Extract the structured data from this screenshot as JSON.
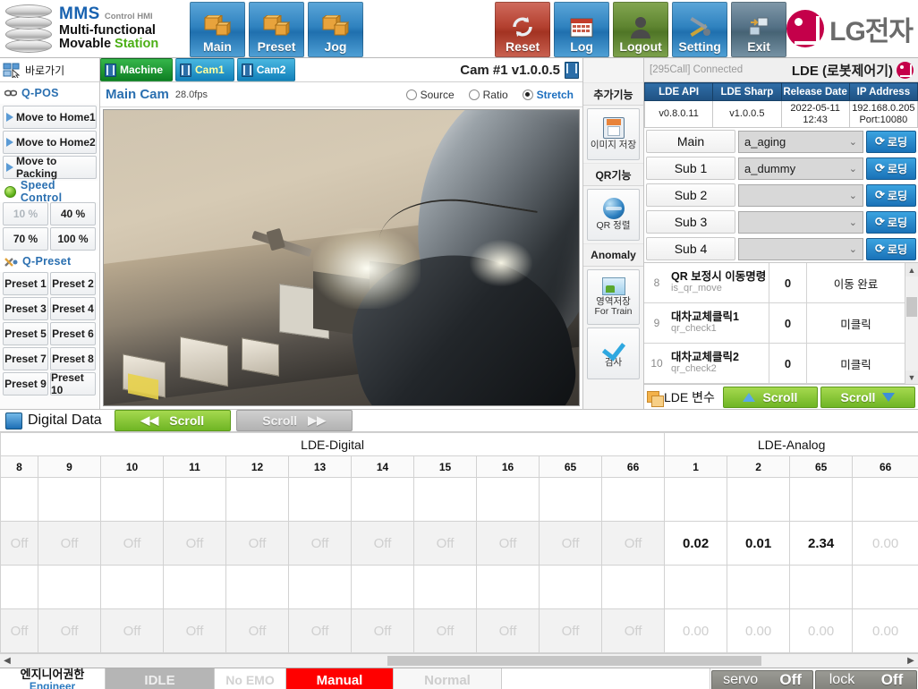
{
  "brand": {
    "mms": "MMS",
    "hmi_sub": "Control HMI",
    "line2": "Multi-functional",
    "line3a": "Movable ",
    "line3b": "Station",
    "lg_text": "LG전자"
  },
  "toolbar": {
    "buttons": [
      {
        "label": "Main",
        "icon": "boxes-icon",
        "color": "#2f82bf"
      },
      {
        "label": "Preset",
        "icon": "boxes-icon",
        "color": "#2f82bf"
      },
      {
        "label": "Jog",
        "icon": "boxes-icon",
        "color": "#2f82bf"
      },
      {
        "label": "Reset",
        "icon": "refresh-icon",
        "color": "#b3402f"
      },
      {
        "label": "Log",
        "icon": "calendar-icon",
        "color": "#2f82bf"
      },
      {
        "label": "Logout",
        "icon": "user-icon",
        "color": "#5e8430"
      },
      {
        "label": "Setting",
        "icon": "tools-icon",
        "color": "#2f82bf"
      },
      {
        "label": "Exit",
        "icon": "exit-icon",
        "color": "#547186"
      }
    ]
  },
  "sidebar": {
    "header": "바로가기",
    "qpos": {
      "title": "Q-POS",
      "items": [
        "Move to Home1",
        "Move to Home2",
        "Move to Packing"
      ]
    },
    "speed": {
      "title": "Speed Control",
      "options": [
        "10 %",
        "40 %",
        "70 %",
        "100 %"
      ],
      "dim_index": 0
    },
    "preset": {
      "title": "Q-Preset",
      "items": [
        "Preset 1",
        "Preset 2",
        "Preset 3",
        "Preset 4",
        "Preset 5",
        "Preset 6",
        "Preset 7",
        "Preset 8",
        "Preset 9",
        "Preset 10"
      ]
    }
  },
  "camera": {
    "tabs": [
      {
        "label": "Machine",
        "active": true
      },
      {
        "label": "Cam1",
        "active": false
      },
      {
        "label": "Cam2",
        "active": false
      }
    ],
    "title": "Cam #1 v1.0.0.5",
    "name": "Main Cam",
    "fps": "28.0fps",
    "modes": [
      {
        "label": "Source",
        "selected": false
      },
      {
        "label": "Ratio",
        "selected": false
      },
      {
        "label": "Stretch",
        "selected": true
      }
    ]
  },
  "functions": {
    "groups": [
      {
        "title": "추가기능",
        "buttons": [
          {
            "label": "이미지 저장",
            "icon": "floppy-icon"
          }
        ]
      },
      {
        "title": "QR기능",
        "buttons": [
          {
            "label": "QR 정렬",
            "icon": "globe-icon"
          }
        ]
      },
      {
        "title": "Anomaly",
        "buttons": [
          {
            "label": "영역저장\nFor Train",
            "icon": "image-icon"
          },
          {
            "label": "검사",
            "icon": "check-icon"
          }
        ]
      }
    ],
    "anomaly_btn1_line1": "영역저장",
    "anomaly_btn1_line2": "For Train",
    "anomaly_btn2": "검사"
  },
  "lde": {
    "connection": "[295Call] Connected",
    "title": "LDE (로봇제어기)",
    "info_headers": [
      "LDE API",
      "LDE Sharp",
      "Release Date",
      "IP Address"
    ],
    "info_values": [
      "v0.8.0.11",
      "v1.0.0.5",
      "2022-05-11\n12:43",
      "192.168.0.205\nPort:10080"
    ],
    "release_date_line1": "2022-05-11",
    "release_date_line2": "12:43",
    "ip_line1": "192.168.0.205",
    "ip_line2": "Port:10080",
    "load_label": "로딩",
    "selectors": [
      {
        "label": "Main",
        "value": "a_aging"
      },
      {
        "label": "Sub 1",
        "value": "a_dummy"
      },
      {
        "label": "Sub 2",
        "value": ""
      },
      {
        "label": "Sub 3",
        "value": ""
      },
      {
        "label": "Sub 4",
        "value": ""
      }
    ],
    "variables": [
      {
        "index": "8",
        "name_kr": "QR 보정시 이동명령",
        "code": "is_qr_move",
        "value": "0",
        "state": "이동 완료"
      },
      {
        "index": "9",
        "name_kr": "대차교체클릭1",
        "code": "qr_check1",
        "value": "0",
        "state": "미클릭"
      },
      {
        "index": "10",
        "name_kr": "대차교체클릭2",
        "code": "qr_check2",
        "value": "0",
        "state": "미클릭"
      }
    ],
    "footer_label": "LDE 변수",
    "scroll_up_label": "Scroll",
    "scroll_down_label": "Scroll"
  },
  "digital_data": {
    "title": "Digital Data",
    "scroll_left_label": "Scroll",
    "scroll_right_label": "Scroll",
    "group_digital": "LDE-Digital",
    "group_analog": "LDE-Analog",
    "digital_columns": [
      "8",
      "9",
      "10",
      "11",
      "12",
      "13",
      "14",
      "15",
      "16",
      "65",
      "66"
    ],
    "analog_columns": [
      "1",
      "2",
      "65",
      "66"
    ],
    "digital_rows": [
      [
        "",
        "",
        "",
        "",
        "",
        "",
        "",
        "",
        "",
        "",
        ""
      ],
      [
        "Off",
        "Off",
        "Off",
        "Off",
        "Off",
        "Off",
        "Off",
        "Off",
        "Off",
        "Off",
        "Off"
      ],
      [
        "",
        "",
        "",
        "",
        "",
        "",
        "",
        "",
        "",
        "",
        ""
      ],
      [
        "Off",
        "Off",
        "Off",
        "Off",
        "Off",
        "Off",
        "Off",
        "Off",
        "Off",
        "Off",
        "Off"
      ]
    ],
    "analog_rows": [
      [
        "",
        "",
        "",
        ""
      ],
      [
        "0.02",
        "0.01",
        "2.34",
        "0.00"
      ],
      [
        "",
        "",
        "",
        ""
      ],
      [
        "0.00",
        "0.00",
        "0.00",
        "0.00"
      ]
    ],
    "analog_dim_flags": [
      [
        true,
        true,
        true,
        true
      ],
      [
        false,
        false,
        false,
        true
      ],
      [
        true,
        true,
        true,
        true
      ],
      [
        true,
        true,
        true,
        true
      ]
    ]
  },
  "status": {
    "auth_kr": "엔지니어권한",
    "auth_en": "Engineer",
    "idle": "IDLE",
    "emo": "No EMO",
    "mode": "Manual",
    "normal": "Normal",
    "servo_label": "servo",
    "servo_value": "Off",
    "lock_label": "lock",
    "lock_value": "Off"
  },
  "colors": {
    "accent_blue": "#2f82bf",
    "alarm_red": "#ff0000",
    "active_green": "#6fb524",
    "lg_magenta": "#c4004a"
  }
}
